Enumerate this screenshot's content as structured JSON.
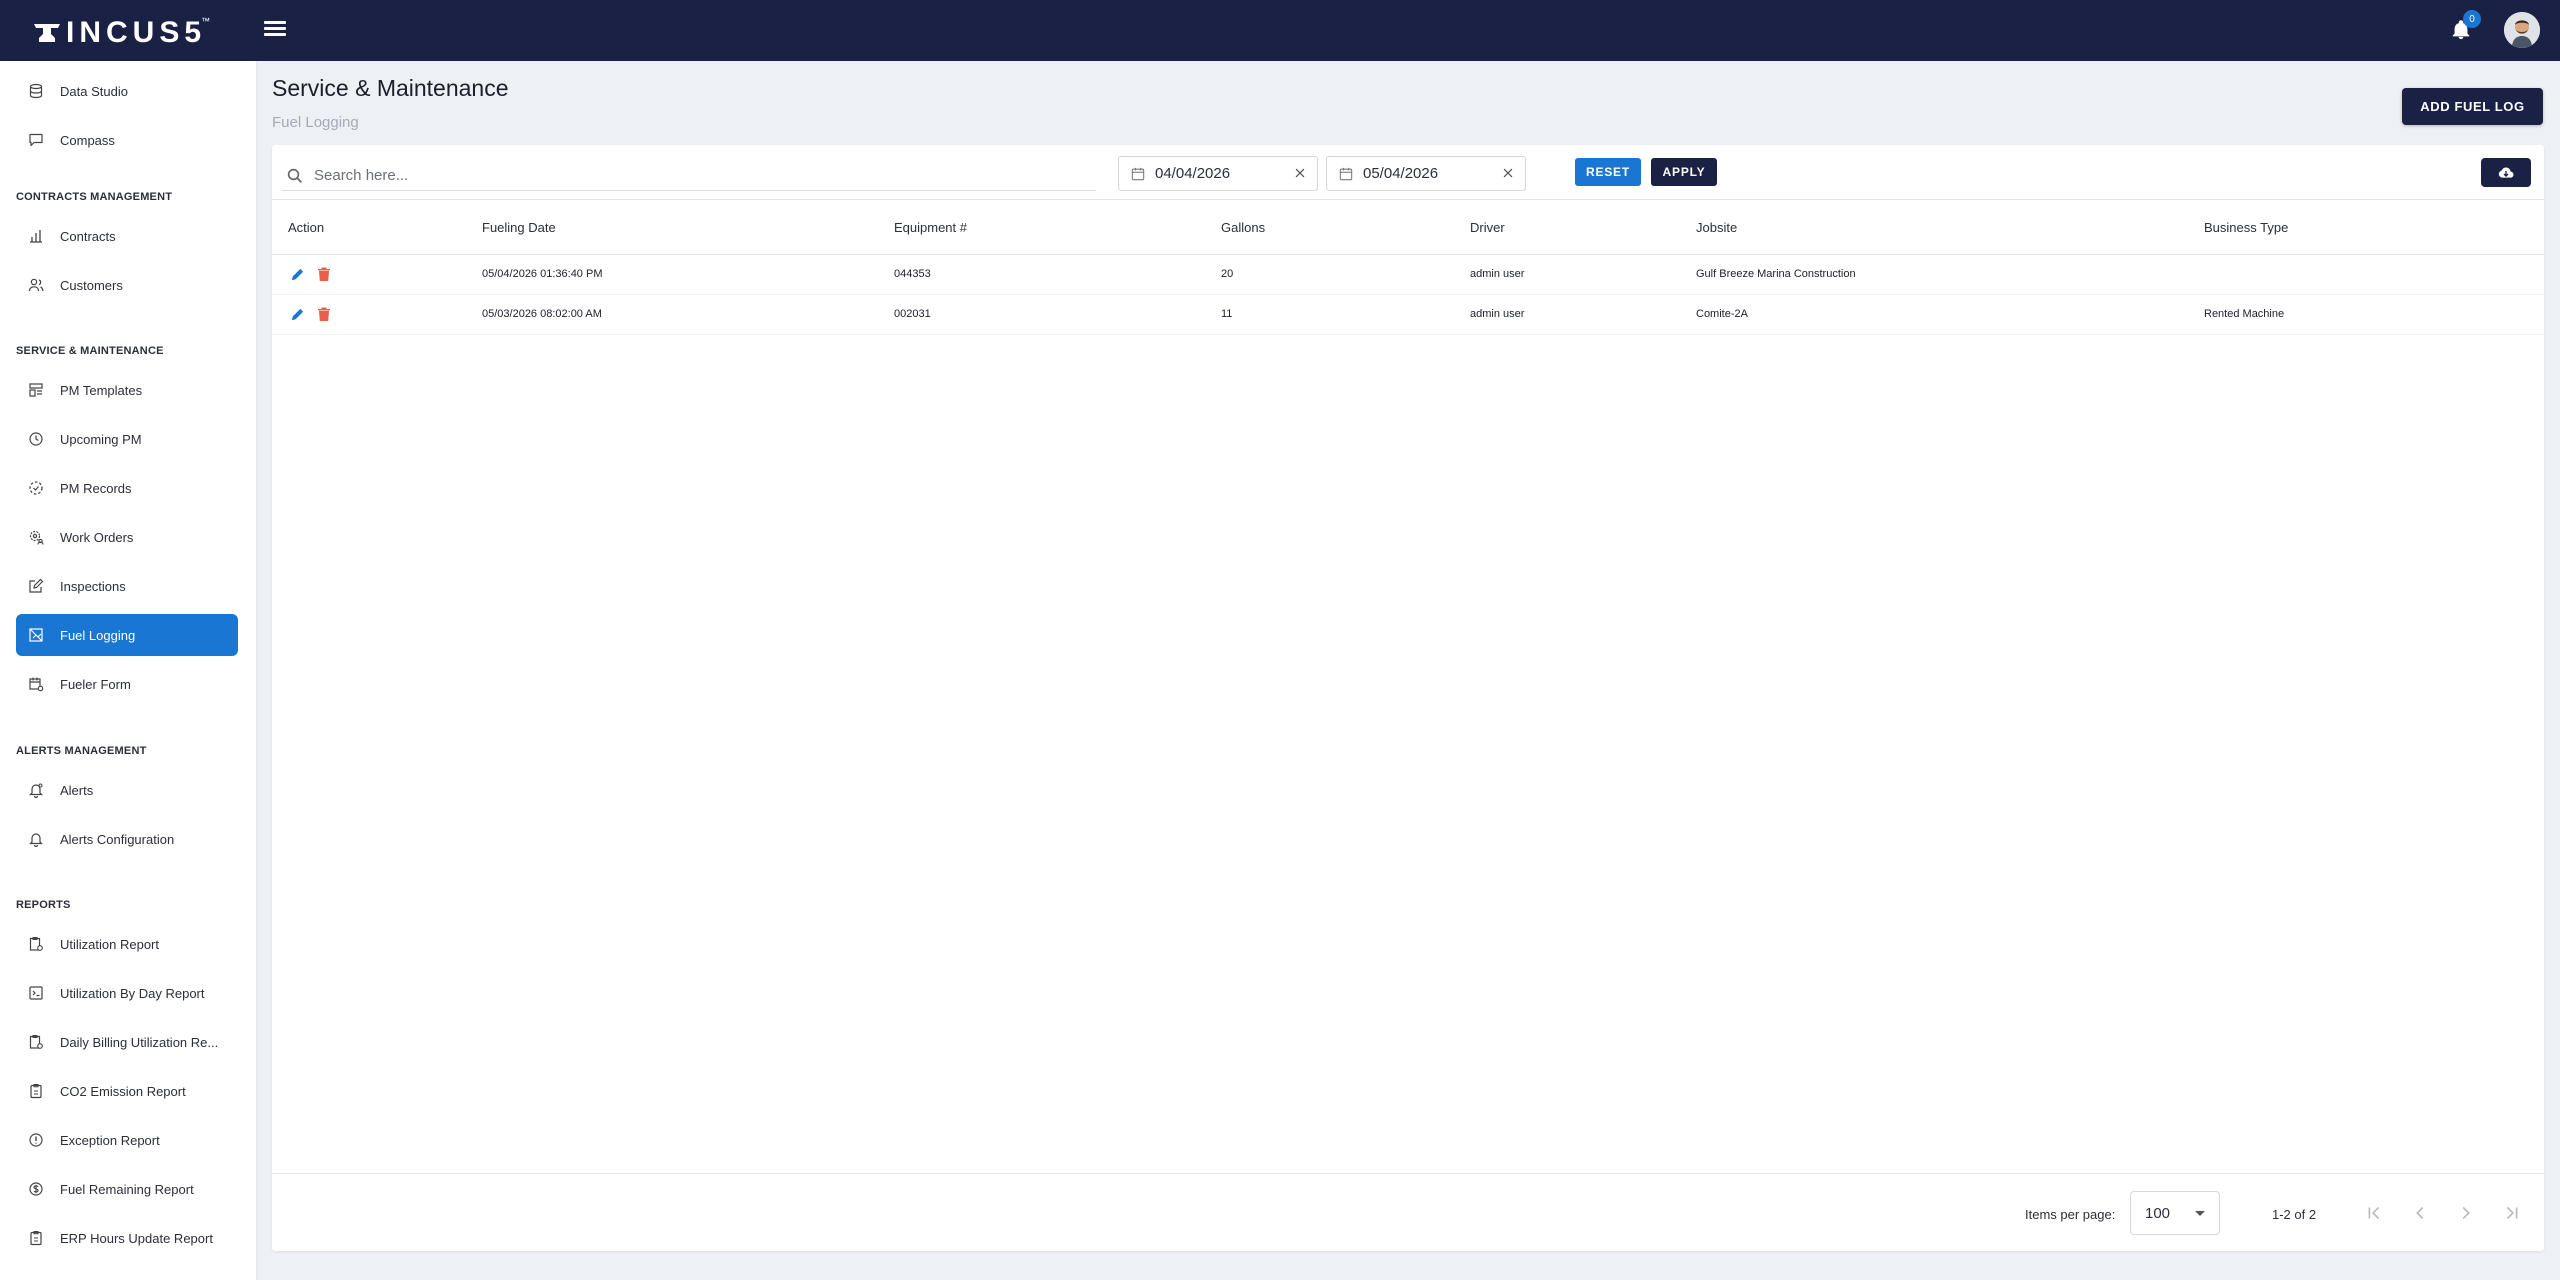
{
  "app": {
    "logo_text": "INCUS",
    "logo_num": "5",
    "logo_tm": "™",
    "notification_count": "0"
  },
  "sidebar": {
    "top_items": [
      {
        "label": "Data Studio",
        "icon": "database-icon"
      },
      {
        "label": "Compass",
        "icon": "chat-icon"
      }
    ],
    "sections": [
      {
        "title": "CONTRACTS MANAGEMENT",
        "items": [
          {
            "label": "Contracts",
            "icon": "chart-icon"
          },
          {
            "label": "Customers",
            "icon": "users-icon"
          }
        ]
      },
      {
        "title": "SERVICE & MAINTENANCE",
        "items": [
          {
            "label": "PM Templates",
            "icon": "template-icon"
          },
          {
            "label": "Upcoming PM",
            "icon": "clock-icon"
          },
          {
            "label": "PM Records",
            "icon": "dashed-circle-icon"
          },
          {
            "label": "Work Orders",
            "icon": "gear-user-icon"
          },
          {
            "label": "Inspections",
            "icon": "edit-icon"
          },
          {
            "label": "Fuel Logging",
            "icon": "fuel-log-icon",
            "active": true
          },
          {
            "label": "Fueler Form",
            "icon": "calendar-gear-icon"
          }
        ]
      },
      {
        "title": "ALERTS MANAGEMENT",
        "items": [
          {
            "label": "Alerts",
            "icon": "bell-icon"
          },
          {
            "label": "Alerts Configuration",
            "icon": "bell-config-icon"
          }
        ]
      },
      {
        "title": "REPORTS",
        "items": [
          {
            "label": "Utilization Report",
            "icon": "report-icon"
          },
          {
            "label": "Utilization By Day Report",
            "icon": "report-day-icon"
          },
          {
            "label": "Daily Billing Utilization Re...",
            "icon": "report-billing-icon"
          },
          {
            "label": "CO2 Emission Report",
            "icon": "clipboard-icon"
          },
          {
            "label": "Exception Report",
            "icon": "info-icon"
          },
          {
            "label": "Fuel Remaining Report",
            "icon": "dollar-icon"
          },
          {
            "label": "ERP Hours Update Report",
            "icon": "clipboard-hours-icon"
          }
        ]
      }
    ]
  },
  "header": {
    "title": "Service & Maintenance",
    "subtitle": "Fuel Logging",
    "add_button": "ADD FUEL LOG"
  },
  "filters": {
    "search_placeholder": "Search here...",
    "date_from": "04/04/2026",
    "date_to": "05/04/2026",
    "reset_label": "RESET",
    "apply_label": "APPLY"
  },
  "table": {
    "columns": [
      "Action",
      "Fueling Date",
      "Equipment #",
      "Gallons",
      "Driver",
      "Jobsite",
      "Business Type"
    ],
    "rows": [
      {
        "fueling_date": "05/04/2026 01:36:40 PM",
        "equipment": "044353",
        "gallons": "20",
        "driver": "admin user",
        "jobsite": "Gulf Breeze Marina Construction",
        "business_type": ""
      },
      {
        "fueling_date": "05/03/2026 08:02:00 AM",
        "equipment": "002031",
        "gallons": "11",
        "driver": "admin user",
        "jobsite": "Comite-2A",
        "business_type": "Rented Machine"
      }
    ]
  },
  "pagination": {
    "items_per_page_label": "Items per page:",
    "items_per_page": "100",
    "range": "1-2 of 2"
  },
  "colors": {
    "navbar": "#1b2144",
    "accent": "#1976d2",
    "delete": "#e8604c"
  }
}
